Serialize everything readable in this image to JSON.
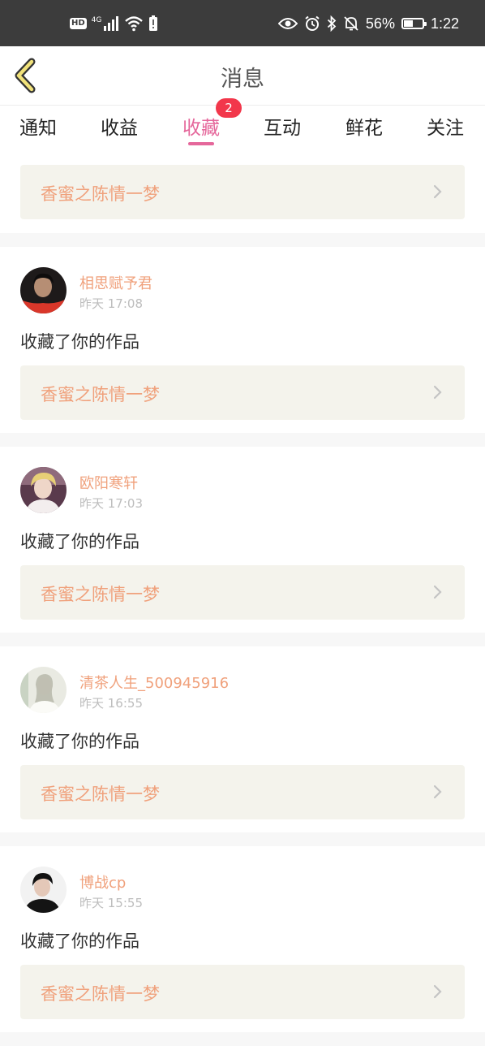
{
  "status_bar": {
    "hd": "HD",
    "network": "4G",
    "battery_percent": "56%",
    "battery_level": 0.56,
    "time": "1:22",
    "icons": [
      "signal-icon",
      "wifi-icon",
      "alert-icon",
      "eye-icon",
      "alarm-icon",
      "bluetooth-icon",
      "bell-off-icon",
      "battery-icon"
    ]
  },
  "header": {
    "title": "消息",
    "back_icon": "chevron-left-icon"
  },
  "tabs": [
    {
      "label": "通知",
      "active": false
    },
    {
      "label": "收益",
      "active": false
    },
    {
      "label": "收藏",
      "active": true,
      "badge": "2"
    },
    {
      "label": "互动",
      "active": false
    },
    {
      "label": "鲜花",
      "active": false
    },
    {
      "label": "关注",
      "active": false
    }
  ],
  "colors": {
    "accent": "#e5679b",
    "badge": "#f2374b",
    "name": "#f0a17c",
    "work_title": "#f0a17c",
    "work_bg": "#f4f3ec",
    "status_bar": "#3c3c3c"
  },
  "first_item": {
    "work_title": "香蜜之陈情一梦"
  },
  "messages": [
    {
      "user": "相思赋予君",
      "time": "昨天 17:08",
      "text": "收藏了你的作品",
      "work_title": "香蜜之陈情一梦"
    },
    {
      "user": "欧阳寒轩",
      "time": "昨天 17:03",
      "text": "收藏了你的作品",
      "work_title": "香蜜之陈情一梦"
    },
    {
      "user": "清茶人生_500945916",
      "time": "昨天 16:55",
      "text": "收藏了你的作品",
      "work_title": "香蜜之陈情一梦"
    },
    {
      "user": "博战cp",
      "time": "昨天 15:55",
      "text": "收藏了你的作品",
      "work_title": "香蜜之陈情一梦"
    }
  ]
}
